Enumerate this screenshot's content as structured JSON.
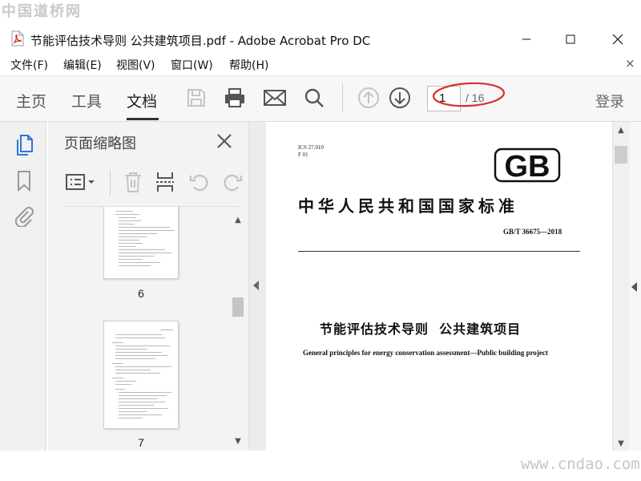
{
  "watermark": {
    "top": "中国道桥网",
    "bottom": "www.cndao.com"
  },
  "window": {
    "title": "节能评估技术导则 公共建筑项目.pdf - Adobe Acrobat Pro DC",
    "app_icon": "pdf-file-icon"
  },
  "menu": {
    "items": [
      "文件(F)",
      "编辑(E)",
      "视图(V)",
      "窗口(W)",
      "帮助(H)"
    ],
    "close_glyph": "×"
  },
  "toolbar": {
    "tabs": [
      {
        "label": "主页",
        "active": false
      },
      {
        "label": "工具",
        "active": false
      },
      {
        "label": "文档",
        "active": true
      }
    ],
    "icons": [
      "save-icon",
      "print-icon",
      "email-icon",
      "search-icon",
      "page-up-icon",
      "page-down-icon"
    ],
    "page": {
      "current": "1",
      "total_label": "/ 16"
    },
    "login_label": "登录",
    "highlight_color": "#d9302c"
  },
  "nav_rail": {
    "icons": [
      "page-thumbnails-icon",
      "bookmark-icon",
      "attachment-icon"
    ]
  },
  "thumbnail_panel": {
    "title": "页面缩略图",
    "tools": [
      "page-options-icon",
      "delete-icon",
      "insert-page-icon",
      "undo-icon",
      "redo-icon"
    ],
    "thumbnails": [
      {
        "label": "6"
      },
      {
        "label": "7"
      }
    ],
    "scroll_position": 0.38
  },
  "document": {
    "ics_line1": "ICS 27.010",
    "ics_line2": "F 01",
    "logo_text": "GB",
    "standard_title": "中华人民共和国国家标准",
    "standard_number": "GB/T 36675—2018",
    "title_cn": "节能评估技术导则  公共建筑项目",
    "title_en": "General principles for energy conservation assessment—Public building project",
    "scroll_position": 0.02
  },
  "colors": {
    "accent": "#2a7ad5",
    "toolbar_bg": "#f7f7f7",
    "panel_bg": "#f3f3f3"
  }
}
